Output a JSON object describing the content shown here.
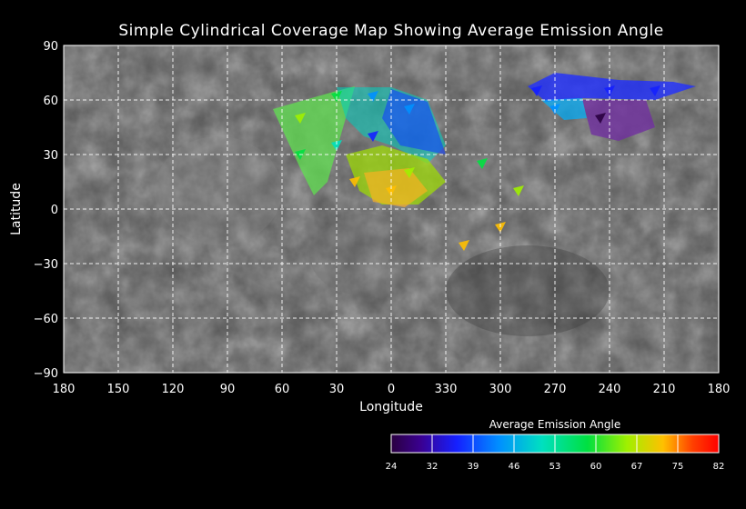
{
  "title": "Simple Cylindrical Coverage Map Showing Average Emission Angle",
  "axes": {
    "xlabel": "Longitude",
    "ylabel": "Latitude",
    "x_ticks": [
      "180",
      "150",
      "120",
      "90",
      "60",
      "30",
      "0",
      "330",
      "300",
      "270",
      "240",
      "210",
      "180"
    ],
    "y_ticks": [
      "90",
      "60",
      "30",
      "0",
      "−30",
      "−60",
      "−90"
    ]
  },
  "colorbar": {
    "title": "Average Emission Angle",
    "ticks": [
      "24",
      "32",
      "39",
      "46",
      "53",
      "60",
      "67",
      "75",
      "82"
    ],
    "colors": [
      "#2a0040",
      "#3a0090",
      "#1520ff",
      "#0090ff",
      "#00e0c0",
      "#00e040",
      "#a0f000",
      "#ffc000",
      "#ff4000",
      "#ff0000"
    ]
  },
  "chart_data": {
    "type": "heatmap",
    "title": "Simple Cylindrical Coverage Map Showing Average Emission Angle",
    "xlabel": "Longitude",
    "ylabel": "Latitude",
    "x_ticks": [
      180,
      150,
      120,
      90,
      60,
      30,
      0,
      330,
      300,
      270,
      240,
      210,
      180
    ],
    "y_ticks": [
      90,
      60,
      30,
      0,
      -30,
      -60,
      -90
    ],
    "ylim": [
      -90,
      90
    ],
    "value_label": "Average Emission Angle",
    "value_range": [
      24,
      82
    ],
    "grid": true,
    "coverage_patches": [
      {
        "lon": 50,
        "lat": 50,
        "value": 60
      },
      {
        "lon": 30,
        "lat": 62,
        "value": 55
      },
      {
        "lon": 10,
        "lat": 62,
        "value": 46
      },
      {
        "lon": 350,
        "lat": 55,
        "value": 46
      },
      {
        "lon": 10,
        "lat": 40,
        "value": 36
      },
      {
        "lon": 30,
        "lat": 35,
        "value": 50
      },
      {
        "lon": 50,
        "lat": 30,
        "value": 58
      },
      {
        "lon": 20,
        "lat": 15,
        "value": 68
      },
      {
        "lon": 0,
        "lat": 10,
        "value": 70
      },
      {
        "lon": 350,
        "lat": 20,
        "value": 62
      },
      {
        "lon": 280,
        "lat": 65,
        "value": 34
      },
      {
        "lon": 240,
        "lat": 65,
        "value": 34
      },
      {
        "lon": 215,
        "lat": 65,
        "value": 37
      },
      {
        "lon": 245,
        "lat": 50,
        "value": 27
      },
      {
        "lon": 270,
        "lat": 55,
        "value": 43
      },
      {
        "lon": 310,
        "lat": 25,
        "value": 55
      },
      {
        "lon": 290,
        "lat": 10,
        "value": 62
      },
      {
        "lon": 300,
        "lat": -10,
        "value": 66
      },
      {
        "lon": 320,
        "lat": -20,
        "value": 72
      }
    ]
  }
}
